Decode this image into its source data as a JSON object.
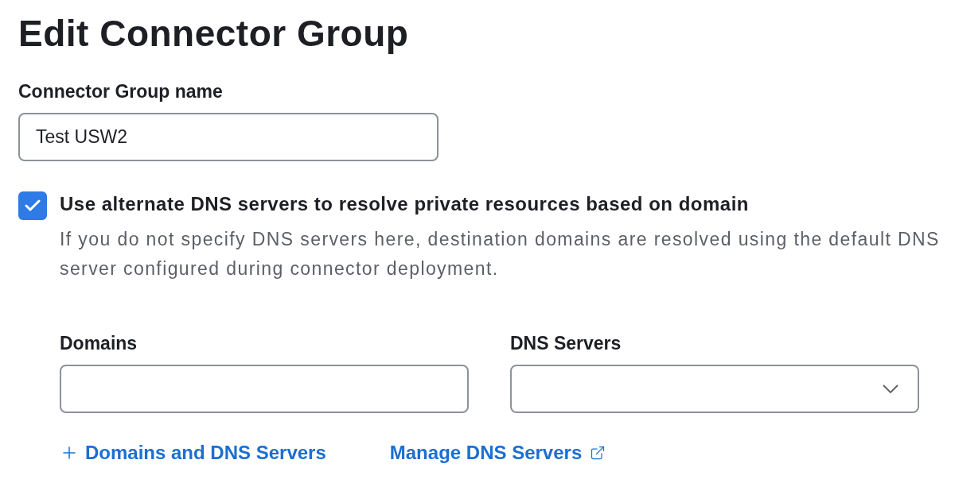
{
  "title": "Edit Connector Group",
  "name_field": {
    "label": "Connector Group name",
    "value": "Test USW2"
  },
  "dns_option": {
    "label": "Use alternate DNS servers to resolve private resources based on domain",
    "checked": true,
    "description": "If you do not specify DNS servers here, destination domains are resolved using the default DNS server configured during connector deployment."
  },
  "domains_field": {
    "label": "Domains"
  },
  "dns_servers_field": {
    "label": "DNS Servers"
  },
  "links": [
    {
      "kind": "add",
      "label": "Domains and DNS Servers"
    },
    {
      "kind": "external",
      "label": "Manage DNS Servers"
    }
  ]
}
